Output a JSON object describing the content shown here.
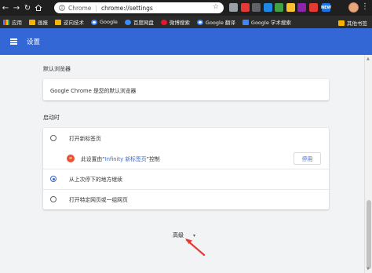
{
  "browser": {
    "back": "←",
    "forward": "→",
    "reload": "↻",
    "origin": "Chrome",
    "url": "chrome://settings",
    "star": "☆",
    "new_badge": "NEW",
    "menu": "⋮",
    "extension_colors": [
      "#9aa0a6",
      "#e53935",
      "#5f6368",
      "#1e88e5",
      "#43a047",
      "#fbc02d",
      "#8e24aa",
      "#e53935"
    ]
  },
  "bookmarks": {
    "items": [
      {
        "label": "应用",
        "icon": "apps-icon"
      },
      {
        "label": "画报",
        "icon": "folder-icon"
      },
      {
        "label": "逆向技术",
        "icon": "folder-icon"
      },
      {
        "label": "Google",
        "icon": "google-icon"
      },
      {
        "label": "百度网盘",
        "icon": "baidu-pan-icon"
      },
      {
        "label": "微博搜索",
        "icon": "weibo-icon"
      },
      {
        "label": "Google 翻译",
        "icon": "google-icon"
      },
      {
        "label": "Google 学术搜索",
        "icon": "scholar-icon"
      }
    ],
    "other": "其他书签"
  },
  "header": {
    "title": "设置"
  },
  "default_browser": {
    "section_title": "默认浏览器",
    "status": "Google Chrome 是您的默认浏览器"
  },
  "startup": {
    "section_title": "启动时",
    "options": [
      {
        "label": "打开新标签页",
        "checked": false
      },
      {
        "label": "从上次停下的地方继续",
        "checked": true
      },
      {
        "label": "打开特定网页或一组网页",
        "checked": false
      }
    ],
    "extension_notice": {
      "prefix": "此设置由“",
      "link": "Infinity 新标签页",
      "suffix": "”控制",
      "button": "停用"
    }
  },
  "advanced": {
    "label": "高级",
    "caret": "▾"
  },
  "colors": {
    "header_blue": "#3367d6",
    "accent_blue": "#3367d6",
    "annotation_red": "#e53935"
  }
}
